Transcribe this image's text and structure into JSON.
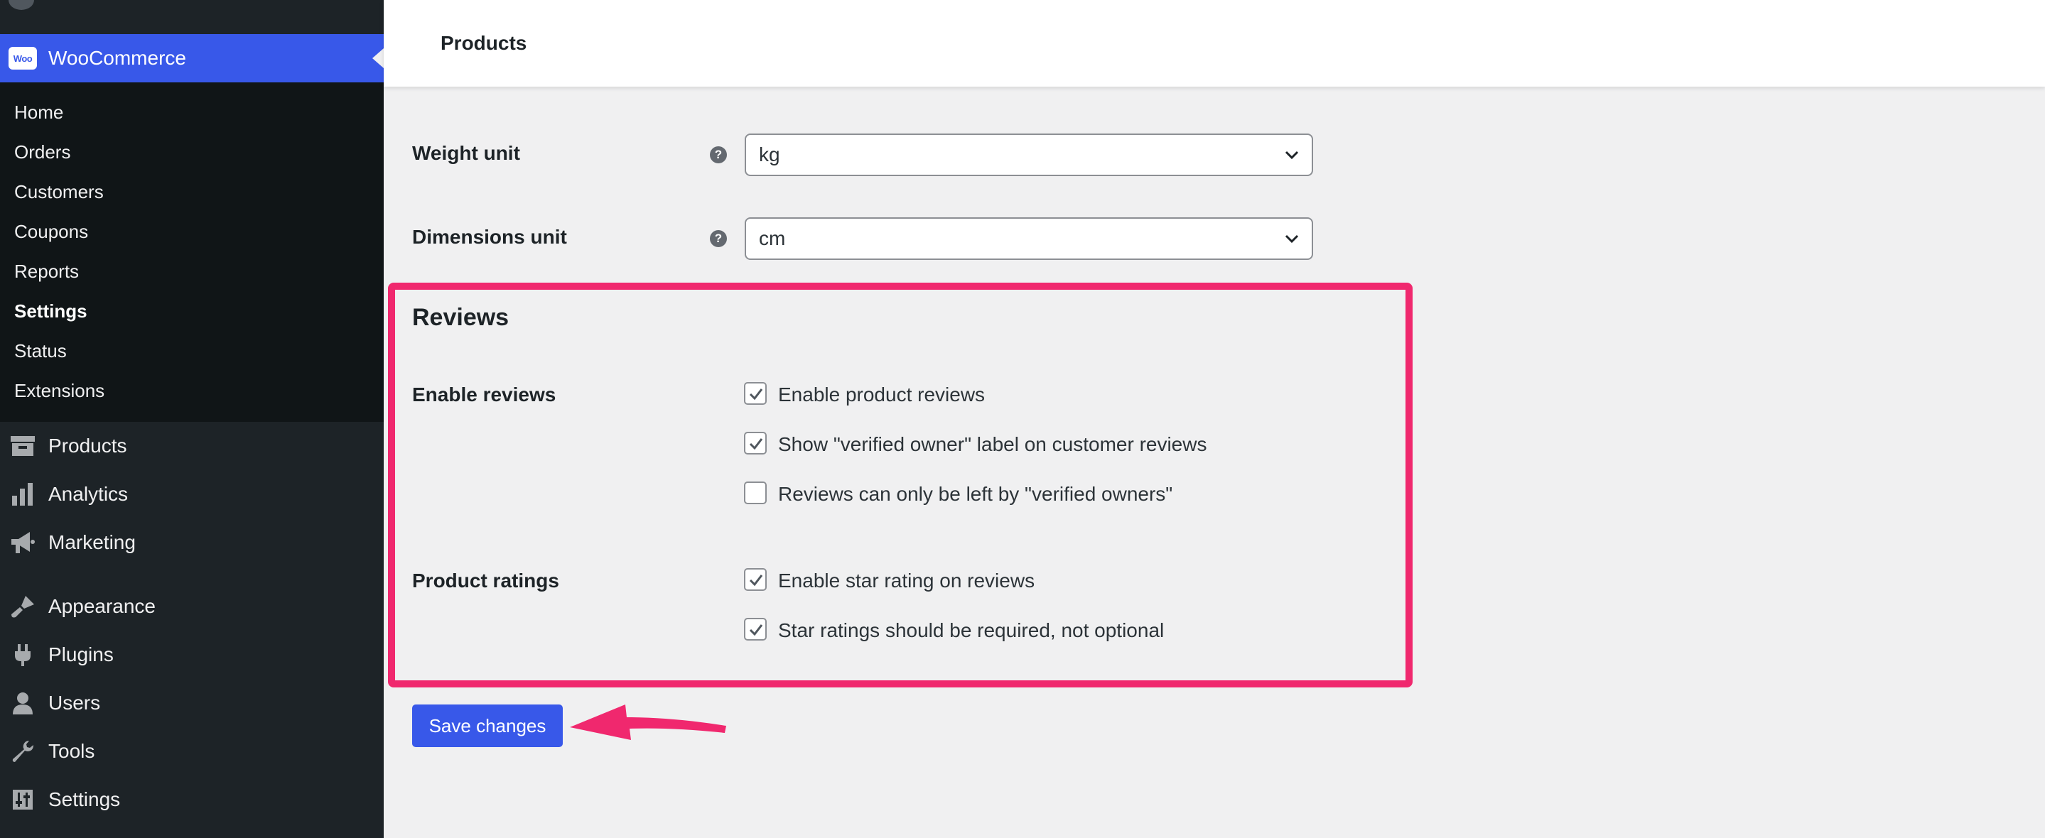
{
  "sidebar": {
    "active_plugin": {
      "label": "WooCommerce",
      "logo_text": "Woo",
      "icon": "woocommerce-logo-icon"
    },
    "submenu": [
      {
        "label": "Home"
      },
      {
        "label": "Orders"
      },
      {
        "label": "Customers"
      },
      {
        "label": "Coupons"
      },
      {
        "label": "Reports"
      },
      {
        "label": "Settings",
        "current": true
      },
      {
        "label": "Status"
      },
      {
        "label": "Extensions"
      }
    ],
    "menu": [
      {
        "label": "Products",
        "icon": "archive-icon"
      },
      {
        "label": "Analytics",
        "icon": "bar-chart-icon"
      },
      {
        "label": "Marketing",
        "icon": "megaphone-icon"
      },
      {
        "label": "Appearance",
        "icon": "paintbrush-icon"
      },
      {
        "label": "Plugins",
        "icon": "plug-icon"
      },
      {
        "label": "Users",
        "icon": "user-icon"
      },
      {
        "label": "Tools",
        "icon": "wrench-icon"
      },
      {
        "label": "Settings",
        "icon": "sliders-icon"
      }
    ]
  },
  "header": {
    "title": "Products"
  },
  "fields": {
    "weight_unit": {
      "label": "Weight unit",
      "value": "kg"
    },
    "dimensions_unit": {
      "label": "Dimensions unit",
      "value": "cm"
    }
  },
  "reviews": {
    "section_title": "Reviews",
    "enable_reviews": {
      "label": "Enable reviews",
      "options": [
        {
          "label": "Enable product reviews",
          "checked": true
        },
        {
          "label": "Show \"verified owner\" label on customer reviews",
          "checked": true
        },
        {
          "label": "Reviews can only be left by \"verified owners\"",
          "checked": false
        }
      ]
    },
    "product_ratings": {
      "label": "Product ratings",
      "options": [
        {
          "label": "Enable star rating on reviews",
          "checked": true
        },
        {
          "label": "Star ratings should be required, not optional",
          "checked": true
        }
      ]
    }
  },
  "actions": {
    "save_label": "Save changes"
  },
  "colors": {
    "accent": "#3858e9",
    "highlight": "#f0286e",
    "sidebar_bg": "#1d2327",
    "submenu_bg": "#101517"
  }
}
